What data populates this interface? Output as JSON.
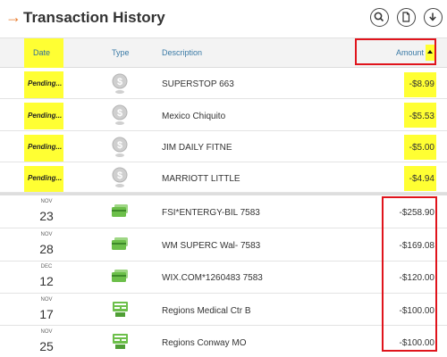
{
  "header": {
    "title": "Transaction History",
    "icons": [
      "search-icon",
      "document-icon",
      "download-icon"
    ]
  },
  "columns": {
    "date": "Date",
    "type": "Type",
    "description": "Description",
    "amount": "Amount"
  },
  "pending": [
    {
      "date": "Pending...",
      "type_icon": "pending-dollar-icon",
      "description": "SUPERSTOP 663",
      "amount": "-$8.99"
    },
    {
      "date": "Pending...",
      "type_icon": "pending-dollar-icon",
      "description": "Mexico Chiquito",
      "amount": "-$5.53"
    },
    {
      "date": "Pending...",
      "type_icon": "pending-dollar-icon",
      "description": "JIM DAILY FITNE",
      "amount": "-$5.00"
    },
    {
      "date": "Pending...",
      "type_icon": "pending-dollar-icon",
      "description": "MARRIOTT LITTLE",
      "amount": "-$4.94"
    }
  ],
  "posted": [
    {
      "month": "NOV",
      "day": "23",
      "type_icon": "card-icon",
      "description": "FSI*ENTERGY-BIL 7583",
      "amount": "-$258.90"
    },
    {
      "month": "NOV",
      "day": "28",
      "type_icon": "card-icon",
      "description": "WM SUPERC Wal- 7583",
      "amount": "-$169.08"
    },
    {
      "month": "DEC",
      "day": "12",
      "type_icon": "card-icon",
      "description": "WIX.COM*1260483 7583",
      "amount": "-$120.00"
    },
    {
      "month": "NOV",
      "day": "17",
      "type_icon": "atm-icon",
      "description": "Regions Medical Ctr B",
      "amount": "-$100.00"
    },
    {
      "month": "NOV",
      "day": "25",
      "type_icon": "atm-icon",
      "description": "Regions Conway MO",
      "amount": "-$100.00"
    }
  ],
  "colors": {
    "highlight": "#ffff33",
    "annotation_red": "#e0141c",
    "accent_orange": "#e8792b",
    "column_header_blue": "#3a7aa6",
    "card_green": "#6cbf4a"
  }
}
